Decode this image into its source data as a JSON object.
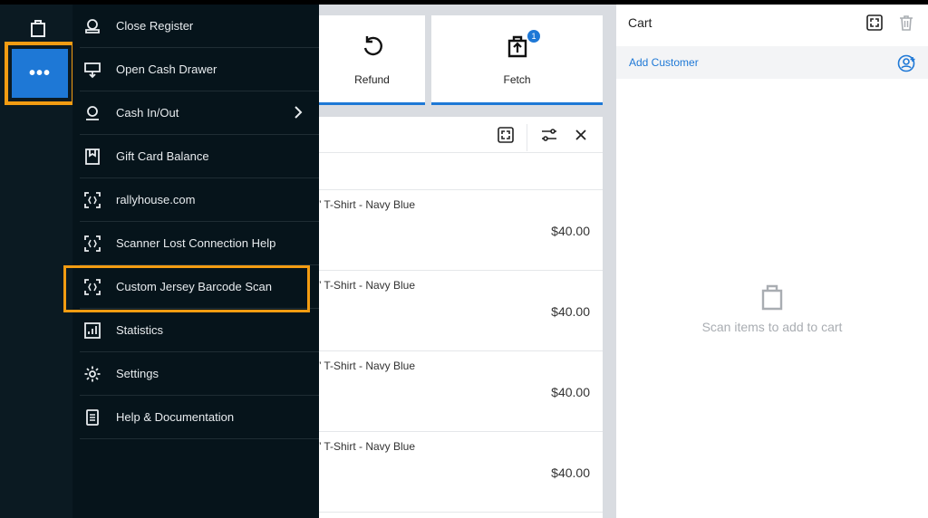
{
  "menu": {
    "items": [
      {
        "label": "Close Register",
        "icon": "register-icon"
      },
      {
        "label": "Open Cash Drawer",
        "icon": "cash-drawer-icon"
      },
      {
        "label": "Cash In/Out",
        "icon": "cash-inout-icon",
        "has_submenu": true
      },
      {
        "label": "Gift Card Balance",
        "icon": "gift-card-icon"
      },
      {
        "label": "rallyhouse.com",
        "icon": "scan-icon"
      },
      {
        "label": "Scanner Lost Connection Help",
        "icon": "scan-icon"
      },
      {
        "label": "Custom Jersey Barcode Scan",
        "icon": "scan-icon",
        "highlighted": true
      },
      {
        "label": "Statistics",
        "icon": "statistics-icon"
      },
      {
        "label": "Settings",
        "icon": "gear-icon"
      },
      {
        "label": "Help & Documentation",
        "icon": "document-icon"
      }
    ]
  },
  "tiles": {
    "refund_label": "Refund",
    "fetch_label": "Fetch",
    "fetch_badge": "1"
  },
  "list": {
    "rows": [
      {
        "name": "’ T-Shirt - Navy Blue",
        "price": "$40.00"
      },
      {
        "name": "’ T-Shirt - Navy Blue",
        "price": "$40.00"
      },
      {
        "name": "’ T-Shirt - Navy Blue",
        "price": "$40.00"
      },
      {
        "name": "’ T-Shirt - Navy Blue",
        "price": "$40.00"
      }
    ]
  },
  "cart": {
    "title": "Cart",
    "add_customer": "Add Customer",
    "empty_message": "Scan items to add to cart"
  },
  "colors": {
    "accent": "#1e78d6",
    "highlight": "#f39c12",
    "menu_bg": "#06141b"
  }
}
